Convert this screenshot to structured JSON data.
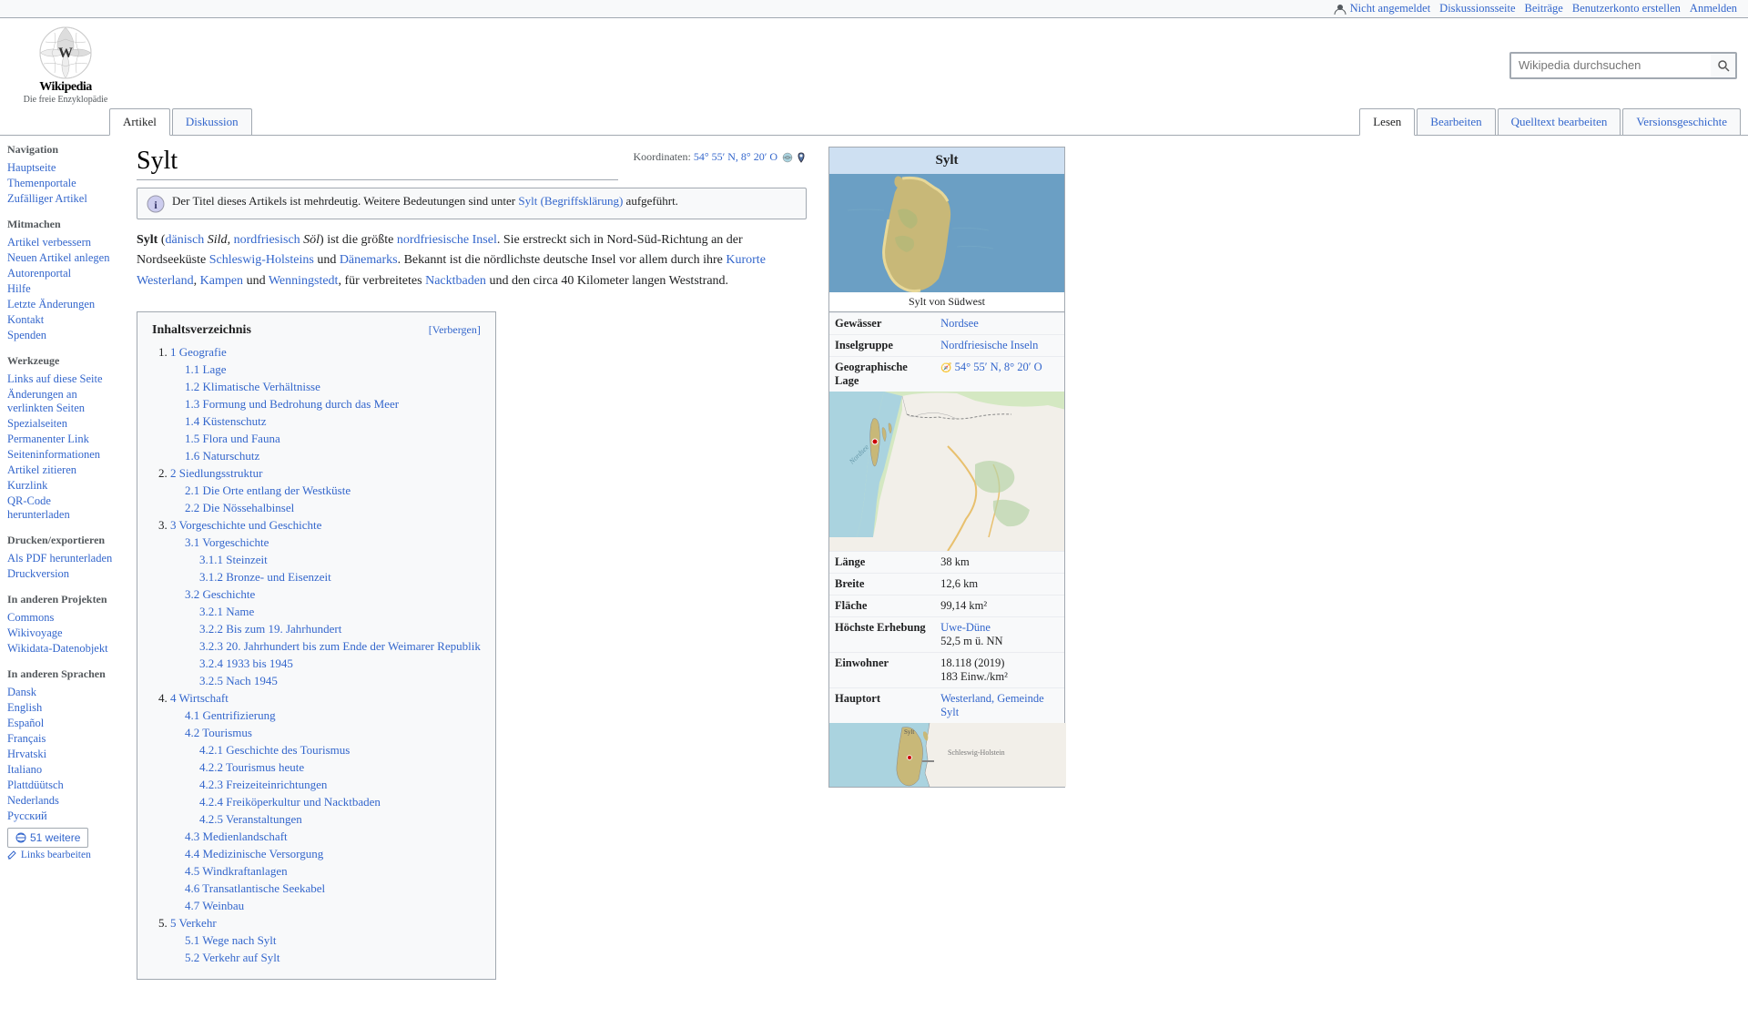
{
  "header": {
    "logo_alt": "Wikipedia",
    "tagline": "Die freie Enzyklopädie",
    "user_bar": {
      "not_logged_in": "Nicht angemeldet",
      "discussion": "Diskussionsseite",
      "contributions": "Beiträge",
      "create_account": "Benutzerkonto erstellen",
      "login": "Anmelden"
    },
    "search_placeholder": "Wikipedia durchsuchen"
  },
  "tabs": {
    "article": "Artikel",
    "discussion": "Diskussion",
    "read": "Lesen",
    "edit": "Bearbeiten",
    "source_edit": "Quelltext bearbeiten",
    "history": "Versionsgeschichte"
  },
  "sidebar": {
    "navigation_title": "Navigation",
    "items": [
      {
        "label": "Hauptseite"
      },
      {
        "label": "Themenportale"
      },
      {
        "label": "Zufälliger Artikel"
      }
    ],
    "participate_title": "Mitmachen",
    "participate_items": [
      {
        "label": "Artikel verbessern"
      },
      {
        "label": "Neuen Artikel anlegen"
      },
      {
        "label": "Autorenportal"
      },
      {
        "label": "Hilfe"
      },
      {
        "label": "Letzte Änderungen"
      },
      {
        "label": "Kontakt"
      },
      {
        "label": "Spenden"
      }
    ],
    "tools_title": "Werkzeuge",
    "tools_items": [
      {
        "label": "Links auf diese Seite"
      },
      {
        "label": "Änderungen an verlinkten Seiten"
      },
      {
        "label": "Spezialseiten"
      },
      {
        "label": "Permanenter Link"
      },
      {
        "label": "Seiteninformationen"
      },
      {
        "label": "Artikel zitieren"
      },
      {
        "label": "Kurzlink"
      },
      {
        "label": "QR-Code herunterladen"
      }
    ],
    "print_title": "Drucken/exportieren",
    "print_items": [
      {
        "label": "Als PDF herunterladen"
      },
      {
        "label": "Druckversion"
      }
    ],
    "other_projects_title": "In anderen Projekten",
    "other_projects_items": [
      {
        "label": "Commons"
      },
      {
        "label": "Wikivoyage"
      },
      {
        "label": "Wikidata-Datenobjekt"
      }
    ],
    "languages_title": "In anderen Sprachen",
    "language_items": [
      {
        "label": "Dansk"
      },
      {
        "label": "English"
      },
      {
        "label": "Español"
      },
      {
        "label": "Français"
      },
      {
        "label": "Hrvatski"
      },
      {
        "label": "Italiano"
      },
      {
        "label": "Plattdüütsch"
      },
      {
        "label": "Nederlands"
      },
      {
        "label": "Русский"
      }
    ],
    "lang_more_btn": "51 weitere",
    "links_bearbeiten": "Links bearbeiten"
  },
  "page": {
    "title": "Sylt",
    "coordinates_label": "Koordinaten:",
    "coordinates_value": "54° 55′ N, 8° 20′ O",
    "disambig_text": "Der Titel dieses Artikels ist mehrdeutig. Weitere Bedeutungen sind unter",
    "disambig_link": "Sylt (Begriffsklärung)",
    "disambig_suffix": "aufgeführt.",
    "intro": "Sylt (dänisch Sild, nordfriesisch Söl) ist die größte nordfriesische Insel. Sie erstreckt sich in Nord-Süd-Richtung an der Nordseeküste Schleswig-Holsteins und Dänemarks. Bekannt ist die nördlichste deutsche Insel vor allem durch ihre Kurorte Westerland, Kampen und Wenningstedt, für verbreitetes Nacktbaden und den circa 40 Kilometer langen Weststrand.",
    "toc": {
      "title": "Inhaltsverzeichnis",
      "toggle": "[Verbergen]",
      "items": [
        {
          "num": "1",
          "label": "Geografie",
          "sub": [
            {
              "num": "1.1",
              "label": "Lage"
            },
            {
              "num": "1.2",
              "label": "Klimatische Verhältnisse"
            },
            {
              "num": "1.3",
              "label": "Formung und Bedrohung durch das Meer"
            },
            {
              "num": "1.4",
              "label": "Küstenschutz"
            },
            {
              "num": "1.5",
              "label": "Flora und Fauna"
            },
            {
              "num": "1.6",
              "label": "Naturschutz"
            }
          ]
        },
        {
          "num": "2",
          "label": "Siedlungsstruktur",
          "sub": [
            {
              "num": "2.1",
              "label": "Die Orte entlang der Westküste"
            },
            {
              "num": "2.2",
              "label": "Die Nössehalbinsel"
            }
          ]
        },
        {
          "num": "3",
          "label": "Vorgeschichte und Geschichte",
          "sub": [
            {
              "num": "3.1",
              "label": "Vorgeschichte",
              "sub2": [
                {
                  "num": "3.1.1",
                  "label": "Steinzeit"
                },
                {
                  "num": "3.1.2",
                  "label": "Bronze- und Eisenzeit"
                }
              ]
            },
            {
              "num": "3.2",
              "label": "Geschichte",
              "sub2": [
                {
                  "num": "3.2.1",
                  "label": "Name"
                },
                {
                  "num": "3.2.2",
                  "label": "Bis zum 19. Jahrhundert"
                },
                {
                  "num": "3.2.3",
                  "label": "20. Jahrhundert bis zum Ende der Weimarer Republik"
                },
                {
                  "num": "3.2.4",
                  "label": "1933 bis 1945"
                },
                {
                  "num": "3.2.5",
                  "label": "Nach 1945"
                }
              ]
            }
          ]
        },
        {
          "num": "4",
          "label": "Wirtschaft",
          "sub": [
            {
              "num": "4.1",
              "label": "Gentrifizierung"
            },
            {
              "num": "4.2",
              "label": "Tourismus",
              "sub2": [
                {
                  "num": "4.2.1",
                  "label": "Geschichte des Tourismus"
                },
                {
                  "num": "4.2.2",
                  "label": "Tourismus heute"
                },
                {
                  "num": "4.2.3",
                  "label": "Freizeiteinrichtungen"
                },
                {
                  "num": "4.2.4",
                  "label": "Freiköperkultur und Nacktbaden"
                },
                {
                  "num": "4.2.5",
                  "label": "Veranstaltungen"
                }
              ]
            },
            {
              "num": "4.3",
              "label": "Medienlandschaft"
            },
            {
              "num": "4.4",
              "label": "Medizinische Versorgung"
            },
            {
              "num": "4.5",
              "label": "Windkraftanlagen"
            },
            {
              "num": "4.6",
              "label": "Transatlantische Seekabel"
            },
            {
              "num": "4.7",
              "label": "Weinbau"
            }
          ]
        },
        {
          "num": "5",
          "label": "Verkehr",
          "sub": [
            {
              "num": "5.1",
              "label": "Wege nach Sylt"
            },
            {
              "num": "5.2",
              "label": "Verkehr auf Sylt"
            }
          ]
        }
      ]
    }
  },
  "infobox": {
    "title": "Sylt",
    "image_caption": "Sylt von Südwest",
    "rows": [
      {
        "label": "Gewässer",
        "value": "Nordsee"
      },
      {
        "label": "Inselgruppe",
        "value": "Nordfriesische Inseln"
      },
      {
        "label": "Geographische Lage",
        "value": "54° 55′ N, 8° 20′ O"
      },
      {
        "label": "Länge",
        "value": "38 km"
      },
      {
        "label": "Breite",
        "value": "12,6 km"
      },
      {
        "label": "Fläche",
        "value": "99,14 km²"
      },
      {
        "label": "Höchste Erhebung",
        "value": "Uwe-Düne",
        "value2": "52,5 m ü. NN"
      },
      {
        "label": "Einwohner",
        "value": "18.118 (2019)",
        "value2": "183 Einw./km²"
      },
      {
        "label": "Hauptort",
        "value": "Westerland, Gemeinde Sylt"
      }
    ]
  }
}
